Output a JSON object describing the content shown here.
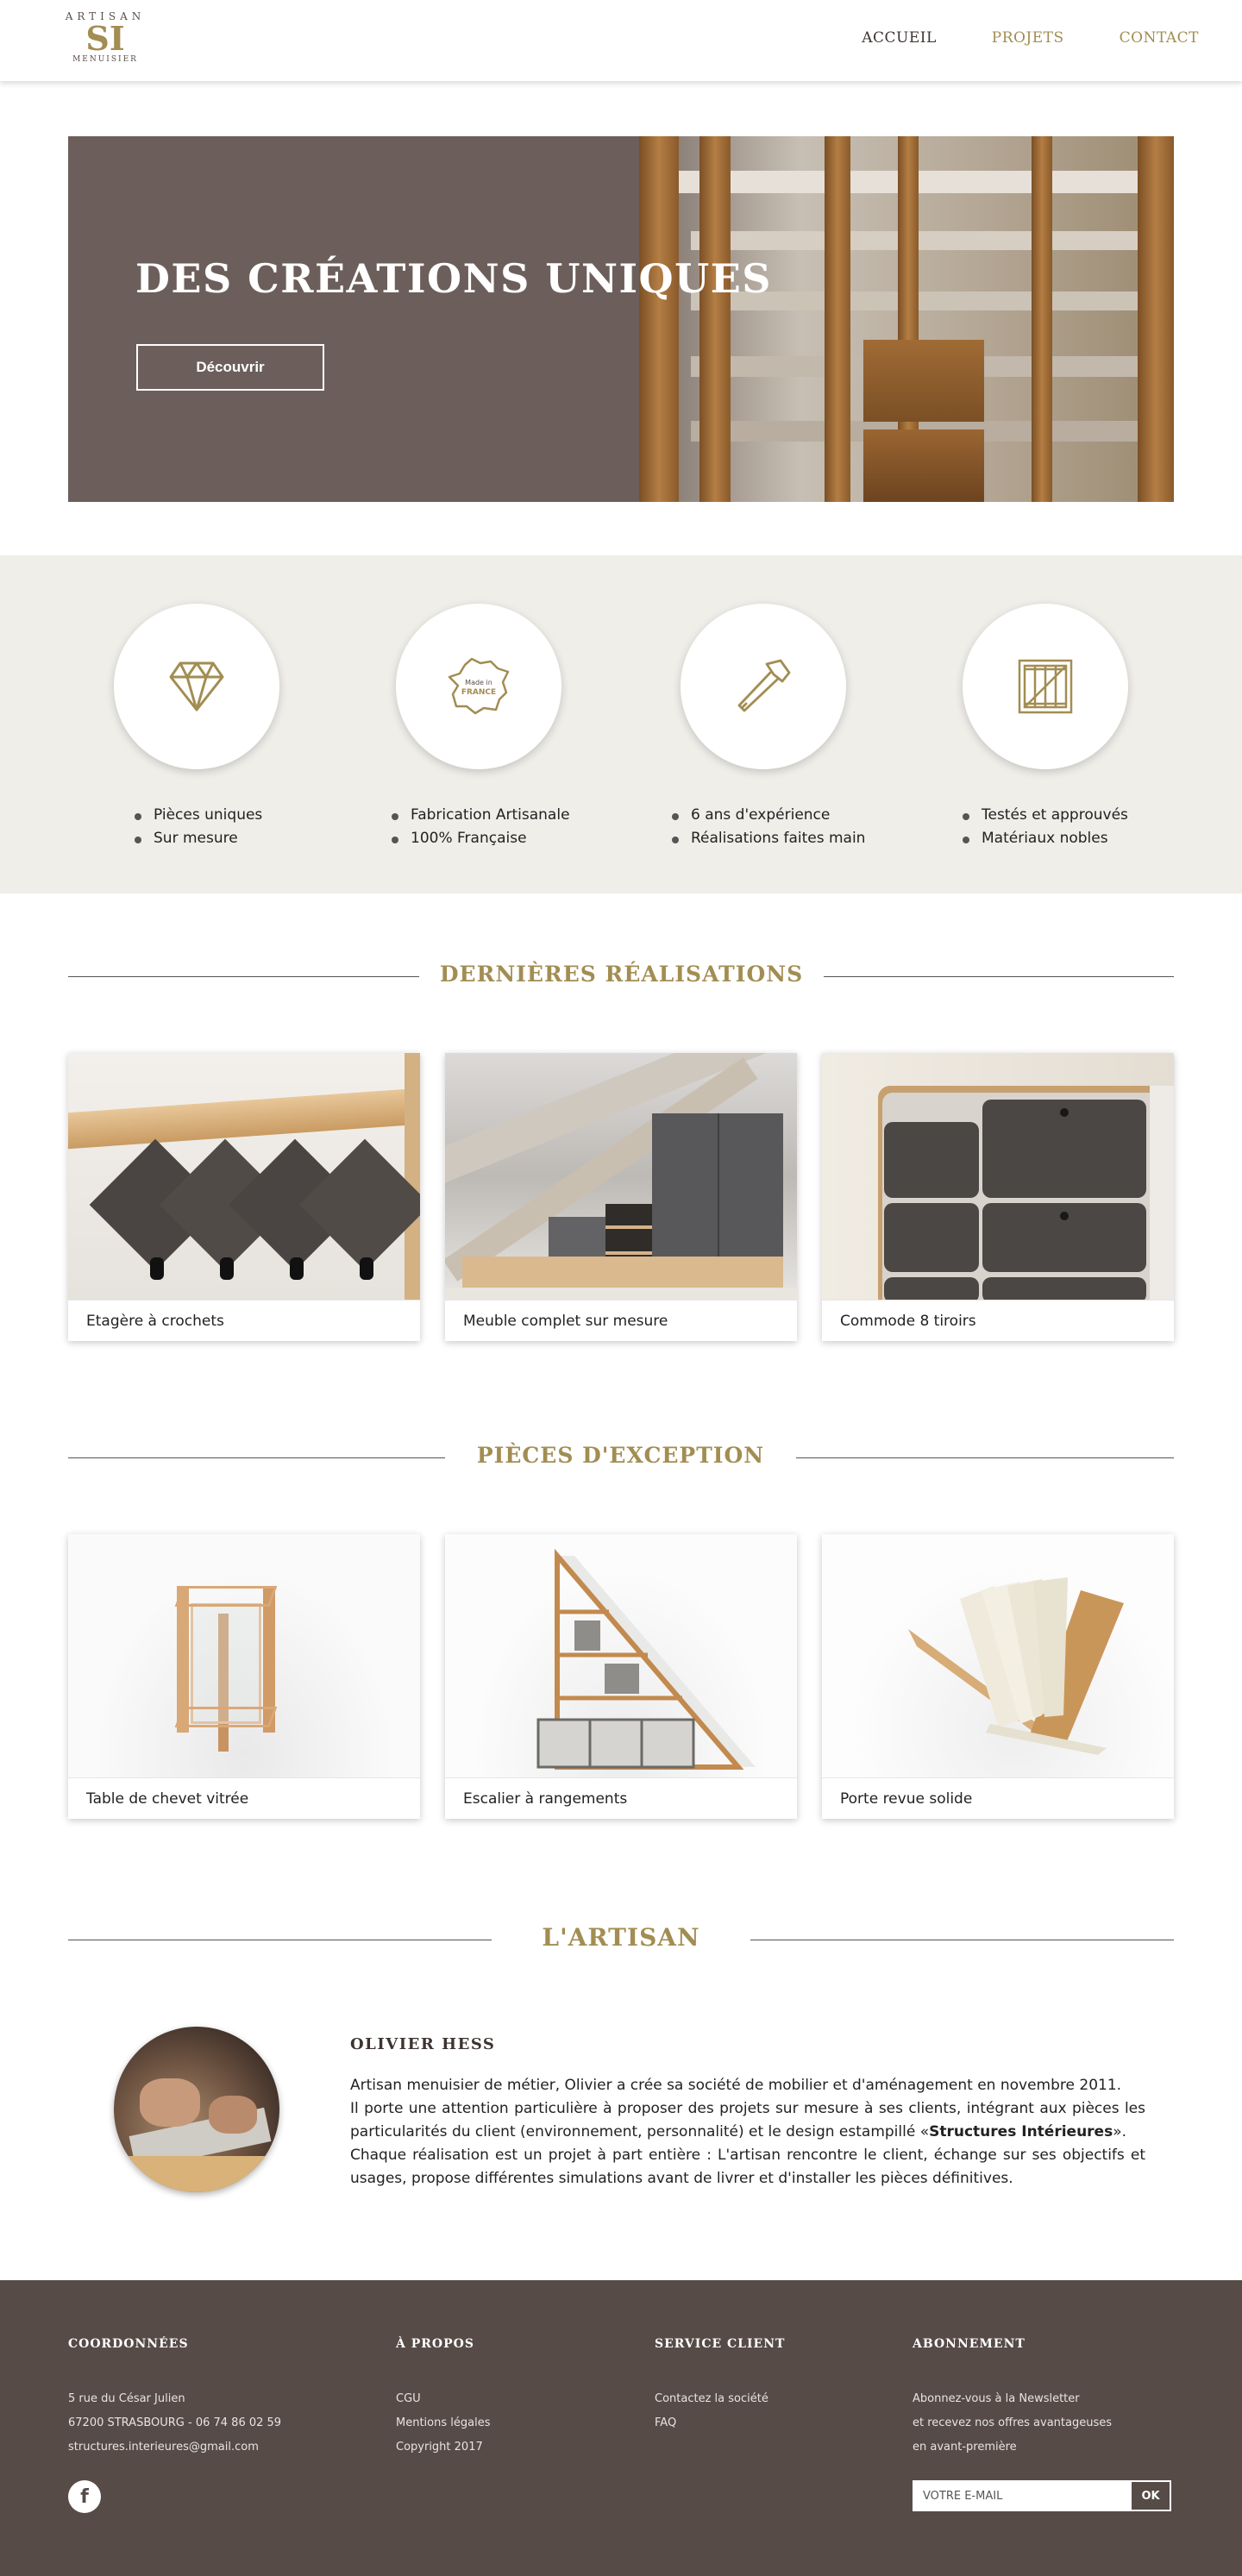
{
  "header": {
    "logo": {
      "top": "ARTISAN",
      "initials": "SI",
      "bottom": "MENUISIER"
    },
    "nav": [
      {
        "label": "ACCUEIL",
        "color": "#3d3432"
      },
      {
        "label": "PROJETS",
        "color": "#a28d52"
      },
      {
        "label": "CONTACT",
        "color": "#a28d52"
      }
    ]
  },
  "hero": {
    "title": "DES CRÉATIONS UNIQUES",
    "button": "Découvrir"
  },
  "features": [
    {
      "icon": "diamond-icon",
      "items": [
        "Pièces uniques",
        "Sur mesure"
      ]
    },
    {
      "icon": "made-in-france-icon",
      "badge": "Made in FRANCE",
      "items": [
        "Fabrication Artisanale",
        "100% Française"
      ]
    },
    {
      "icon": "hammer-icon",
      "items": [
        "6 ans d'expérience",
        "Réalisations faites main"
      ]
    },
    {
      "icon": "crate-icon",
      "items": [
        "Testés et approuvés",
        "Matériaux nobles"
      ]
    }
  ],
  "sections": {
    "latest": "DERNIÈRES RÉALISATIONS",
    "exception": "PIÈCES D'EXCEPTION",
    "artisan": "L'ARTISAN"
  },
  "latest_cards": [
    {
      "caption": "Etagère à crochets"
    },
    {
      "caption": "Meuble complet sur mesure"
    },
    {
      "caption": "Commode 8 tiroirs"
    }
  ],
  "exception_cards": [
    {
      "caption": "Table de chevet vitrée"
    },
    {
      "caption": "Escalier à rangements"
    },
    {
      "caption": "Porte revue solide"
    }
  ],
  "artisan": {
    "name": "OLIVIER HESS",
    "text_1": "Artisan menuisier de métier, Olivier a crée sa société de mobilier et d'aménagement en novembre 2011.",
    "text_2a": "Il porte une attention particulière à proposer des projets sur mesure à ses clients, intégrant aux pièces les particularités du client (environnement, personnalité) et le design estampillé «",
    "text_2b": "Structures Intérieures",
    "text_2c": "».",
    "text_3": "Chaque réalisation est un projet à part entière : L'artisan rencontre le client, échange sur ses objectifs et usages, propose différentes simulations avant de livrer et d'installer les pièces définitives."
  },
  "footer": {
    "coords": {
      "title": "COORDONNÉES",
      "lines": [
        "5 rue du César Julien",
        "67200 STRASBOURG - 06 74 86 02 59",
        "structures.interieures@gmail.com"
      ]
    },
    "about": {
      "title": "À PROPOS",
      "lines": [
        "CGU",
        "Mentions légales",
        "Copyright 2017"
      ]
    },
    "service": {
      "title": "SERVICE CLIENT",
      "lines": [
        "Contactez la société",
        "FAQ"
      ]
    },
    "newsletter": {
      "title": "ABONNEMENT",
      "lines": [
        "Abonnez-vous à la Newsletter",
        "et recevez nos offres avantageuses",
        "en avant-première"
      ],
      "placeholder": "VOTRE E-MAIL",
      "button": "OK"
    },
    "facebook": "f"
  },
  "colors": {
    "accent": "#a28d52",
    "brown": "#564b47",
    "hero": "#6c5f5b",
    "band": "#f0eee9"
  }
}
